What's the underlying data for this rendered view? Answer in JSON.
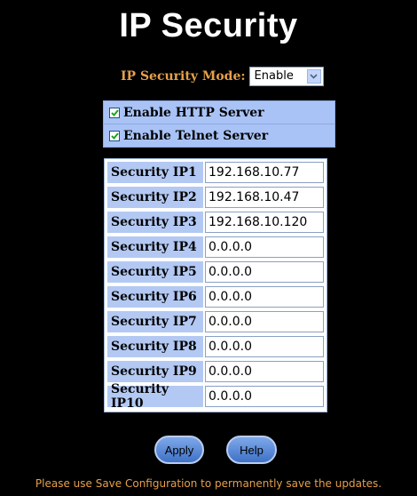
{
  "page": {
    "title": "IP Security"
  },
  "mode": {
    "label": "IP Security Mode:",
    "selected": "Enable"
  },
  "servers": [
    {
      "label": "Enable HTTP Server",
      "checked": true
    },
    {
      "label": "Enable Telnet Server",
      "checked": true
    }
  ],
  "security_ips": [
    {
      "label": "Security IP1",
      "value": "192.168.10.77"
    },
    {
      "label": "Security IP2",
      "value": "192.168.10.47"
    },
    {
      "label": "Security IP3",
      "value": "192.168.10.120"
    },
    {
      "label": "Security IP4",
      "value": "0.0.0.0"
    },
    {
      "label": "Security IP5",
      "value": "0.0.0.0"
    },
    {
      "label": "Security IP6",
      "value": "0.0.0.0"
    },
    {
      "label": "Security IP7",
      "value": "0.0.0.0"
    },
    {
      "label": "Security IP8",
      "value": "0.0.0.0"
    },
    {
      "label": "Security IP9",
      "value": "0.0.0.0"
    },
    {
      "label": "Security IP10",
      "value": "0.0.0.0"
    }
  ],
  "buttons": {
    "apply": "Apply",
    "help": "Help"
  },
  "footer": {
    "note": "Please use Save Configuration to permanently save the updates."
  },
  "colors": {
    "background": "#000000",
    "accent_text": "#e6a04a",
    "label_cell": "#b3c9f3",
    "button": "#5a8ad8"
  }
}
